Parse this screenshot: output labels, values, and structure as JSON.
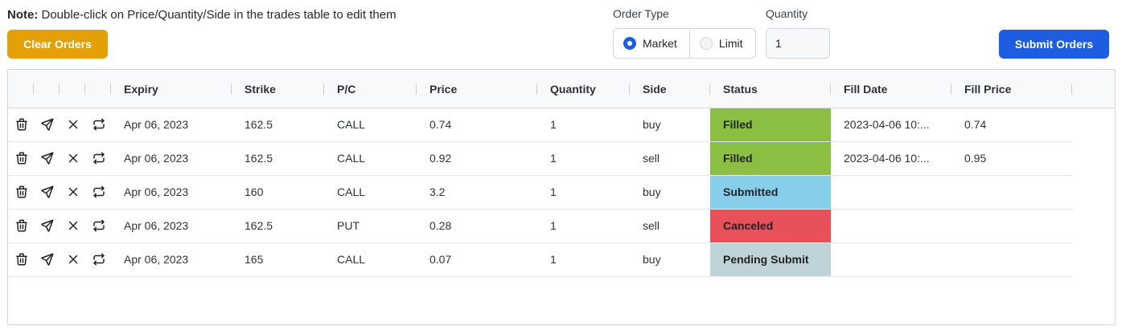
{
  "note": {
    "bold": "Note:",
    "text": " Double-click on Price/Quantity/Side in the trades table to edit them"
  },
  "buttons": {
    "clear": "Clear Orders",
    "submit": "Submit Orders"
  },
  "order_type": {
    "label": "Order Type",
    "options": [
      "Market",
      "Limit"
    ],
    "selected": "Market"
  },
  "quantity": {
    "label": "Quantity",
    "value": "1"
  },
  "colors": {
    "clear_button": "#e3a008",
    "submit_button": "#1d5ee0",
    "filled": "#8bbf43",
    "submitted": "#87ceeb",
    "canceled": "#e8515a",
    "pending": "#bfd3d9"
  },
  "table": {
    "columns": [
      "Expiry",
      "Strike",
      "P/C",
      "Price",
      "Quantity",
      "Side",
      "Status",
      "Fill Date",
      "Fill Price"
    ],
    "action_icons": [
      "trash-icon",
      "send-icon",
      "close-icon",
      "repeat-icon"
    ],
    "rows": [
      {
        "expiry": "Apr 06, 2023",
        "strike": "162.5",
        "pc": "CALL",
        "price": "0.74",
        "quantity": "1",
        "side": "buy",
        "status": "Filled",
        "status_color": "#8bbf43",
        "fill_date": "2023-04-06 10:...",
        "fill_price": "0.74"
      },
      {
        "expiry": "Apr 06, 2023",
        "strike": "162.5",
        "pc": "CALL",
        "price": "0.92",
        "quantity": "1",
        "side": "sell",
        "status": "Filled",
        "status_color": "#8bbf43",
        "fill_date": "2023-04-06 10:...",
        "fill_price": "0.95"
      },
      {
        "expiry": "Apr 06, 2023",
        "strike": "160",
        "pc": "CALL",
        "price": "3.2",
        "quantity": "1",
        "side": "buy",
        "status": "Submitted",
        "status_color": "#87ceeb",
        "fill_date": "",
        "fill_price": ""
      },
      {
        "expiry": "Apr 06, 2023",
        "strike": "162.5",
        "pc": "PUT",
        "price": "0.28",
        "quantity": "1",
        "side": "sell",
        "status": "Canceled",
        "status_color": "#e8515a",
        "fill_date": "",
        "fill_price": ""
      },
      {
        "expiry": "Apr 06, 2023",
        "strike": "165",
        "pc": "CALL",
        "price": "0.07",
        "quantity": "1",
        "side": "buy",
        "status": "Pending Submit",
        "status_color": "#bfd3d9",
        "fill_date": "",
        "fill_price": ""
      }
    ]
  }
}
